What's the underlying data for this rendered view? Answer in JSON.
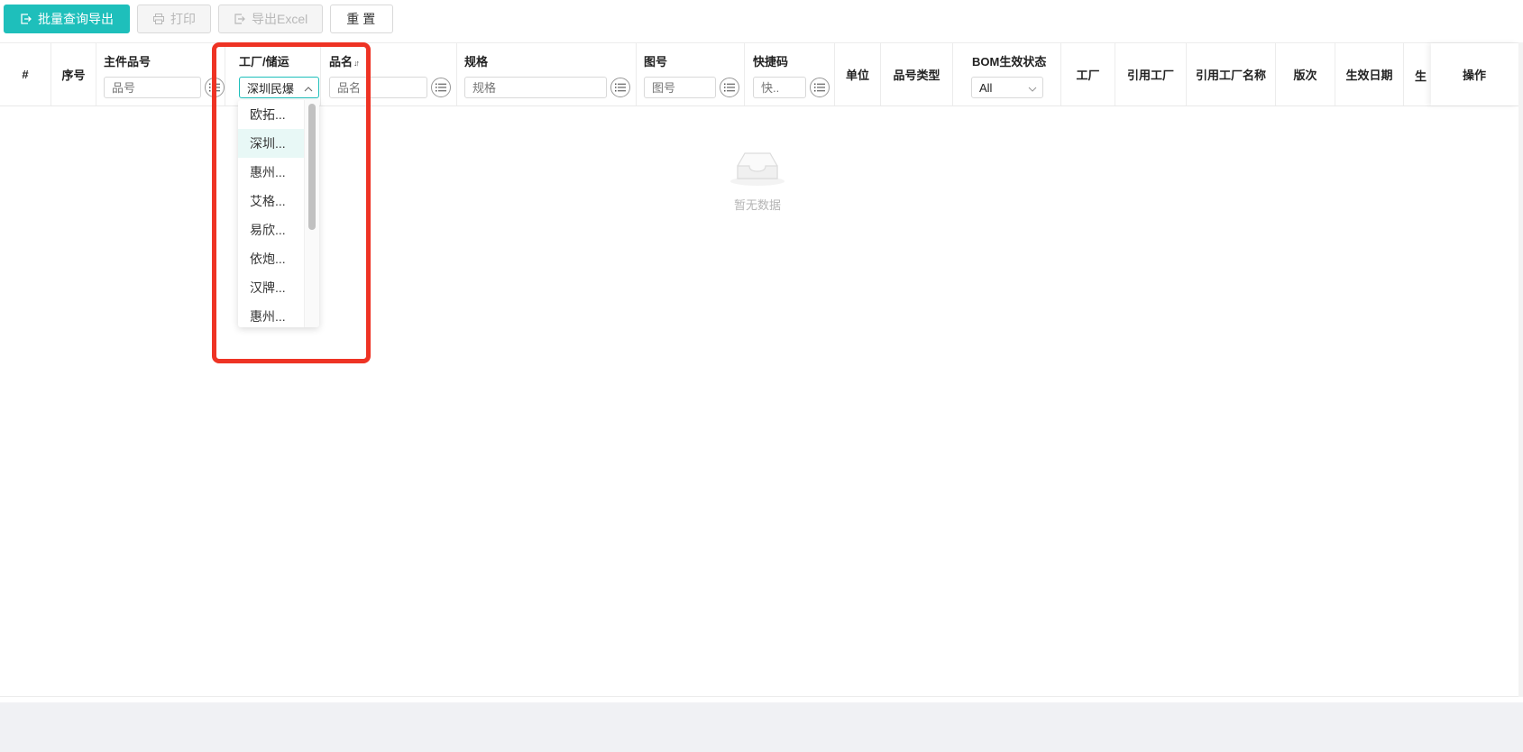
{
  "toolbar": {
    "batch_export_label": "批量查询导出",
    "print_label": "打印",
    "export_excel_label": "导出Excel",
    "reset_label": "重置"
  },
  "columns": {
    "hash": "#",
    "seq": "序号",
    "main_part_no": "主件品号",
    "factory": "工厂/储运",
    "part_name": "品名",
    "spec": "规格",
    "drawing_no": "图号",
    "shortcut_code": "快捷码",
    "unit": "单位",
    "part_type": "品号类型",
    "bom_status": "BOM生效状态",
    "plant": "工厂",
    "ref_plant": "引用工厂",
    "ref_plant_name": "引用工厂名称",
    "version": "版次",
    "effective_date": "生效日期",
    "next_partial": "生",
    "operation": "操作"
  },
  "filters": {
    "main_part_no_placeholder": "品号",
    "factory_selected": "深圳民爆",
    "part_name_placeholder": "品名",
    "spec_placeholder": "规格",
    "drawing_no_placeholder": "图号",
    "shortcut_placeholder": "快..",
    "bom_status_selected": "All"
  },
  "dropdown": {
    "options": [
      "欧拓...",
      "深圳...",
      "惠州...",
      "艾格...",
      "易欣...",
      "依炮...",
      "汉牌...",
      "惠州..."
    ],
    "active_index": 1
  },
  "empty": {
    "text": "暂无数据"
  },
  "colors": {
    "accent": "#1ebfbb",
    "highlight": "#ee3324"
  }
}
